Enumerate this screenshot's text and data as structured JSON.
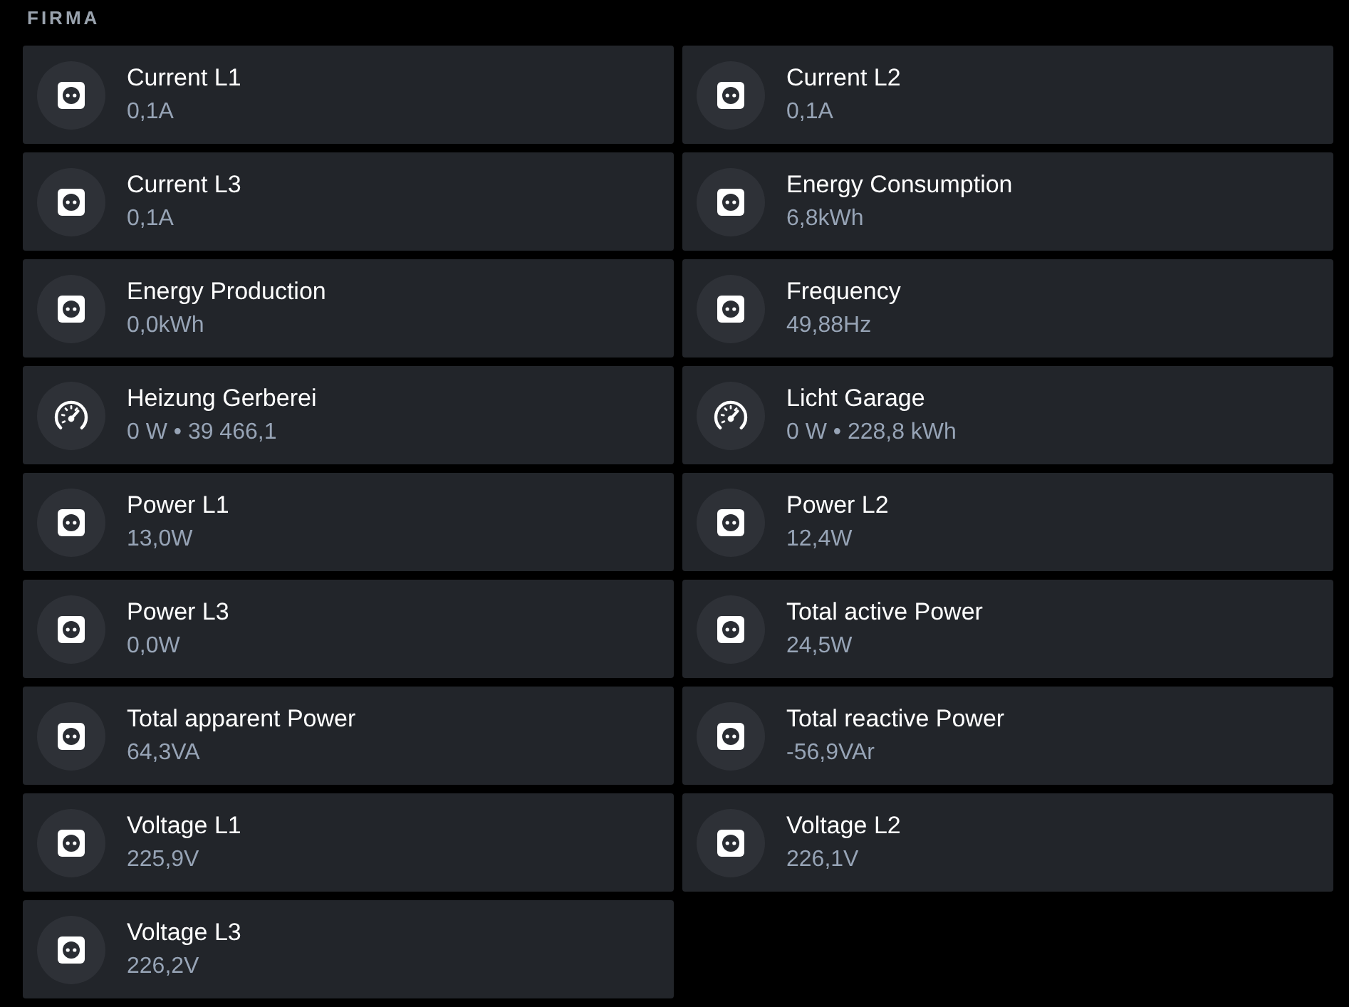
{
  "section": {
    "title": "FIRMA"
  },
  "cards": [
    {
      "kind": "socket",
      "name": "Current L1",
      "value": "0,1A"
    },
    {
      "kind": "socket",
      "name": "Current L2",
      "value": "0,1A"
    },
    {
      "kind": "socket",
      "name": "Current L3",
      "value": "0,1A"
    },
    {
      "kind": "socket",
      "name": "Energy Consumption",
      "value": "6,8kWh"
    },
    {
      "kind": "socket",
      "name": "Energy Production",
      "value": "0,0kWh"
    },
    {
      "kind": "socket",
      "name": "Frequency",
      "value": "49,88Hz"
    },
    {
      "kind": "gauge",
      "name": "Heizung Gerberei",
      "value": "0 W • 39 466,1"
    },
    {
      "kind": "gauge",
      "name": "Licht Garage",
      "value": "0 W • 228,8 kWh"
    },
    {
      "kind": "socket",
      "name": "Power L1",
      "value": "13,0W"
    },
    {
      "kind": "socket",
      "name": "Power L2",
      "value": "12,4W"
    },
    {
      "kind": "socket",
      "name": "Power L3",
      "value": "0,0W"
    },
    {
      "kind": "socket",
      "name": "Total active Power",
      "value": "24,5W"
    },
    {
      "kind": "socket",
      "name": "Total apparent Power",
      "value": "64,3VA"
    },
    {
      "kind": "socket",
      "name": "Total reactive Power",
      "value": "-56,9VAr"
    },
    {
      "kind": "socket",
      "name": "Voltage L1",
      "value": "225,9V"
    },
    {
      "kind": "socket",
      "name": "Voltage L2",
      "value": "226,1V"
    },
    {
      "kind": "socket",
      "name": "Voltage L3",
      "value": "226,2V"
    }
  ]
}
